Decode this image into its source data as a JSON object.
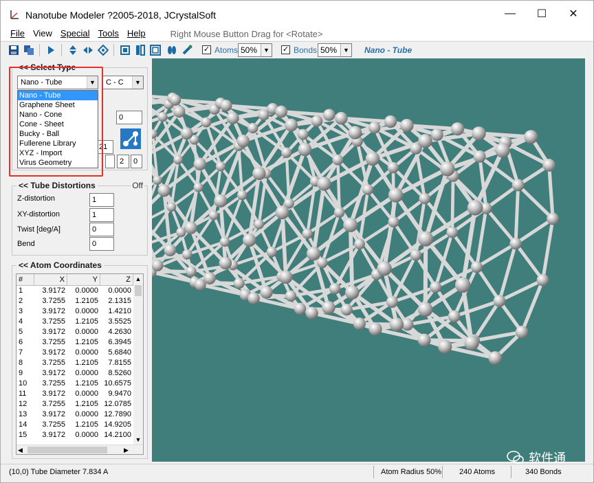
{
  "window": {
    "title": "Nanotube Modeler ?2005-2018, JCrystalSoft",
    "controls": {
      "minimize": "—",
      "maximize": "☐",
      "close": "✕"
    }
  },
  "menu": {
    "file": "File",
    "view": "View",
    "special": "Special",
    "tools": "Tools",
    "help": "Help",
    "hint": "Right Mouse Button Drag for <Rotate>"
  },
  "toolbar": {
    "atoms_checked": true,
    "atoms_label": "Atoms",
    "atoms_percent": "50%",
    "bonds_checked": true,
    "bonds_label": "Bonds",
    "bonds_percent": "50%",
    "mode_label": "Nano - Tube"
  },
  "select_type": {
    "title": "<< Select Type",
    "type_value": "Nano - Tube",
    "bond_value": "C - C",
    "options": [
      "Nano - Tube",
      "Graphene Sheet",
      "Nano - Cone",
      "Cone - Sheet",
      "Bucky - Ball",
      "Fullerene Library",
      "XYZ - Import",
      "Virus Geometry"
    ],
    "selected_index": 0,
    "hidden_field_1": "0",
    "hidden_field_2": "21",
    "hidden_field_3": "2",
    "hidden_field_4": "0"
  },
  "tube_distortions": {
    "title": "<< Tube Distortions",
    "state": "Off",
    "z_label": "Z-distortion",
    "z_value": "1",
    "xy_label": "XY-distortion",
    "xy_value": "1",
    "twist_label": "Twist [deg/A]",
    "twist_value": "0",
    "bend_label": "Bend",
    "bend_value": "0"
  },
  "atom_coordinates": {
    "title": "<< Atom Coordinates",
    "columns": [
      "#",
      "X",
      "Y",
      "Z"
    ],
    "rows": [
      [
        "1",
        "3.9172",
        "0.0000",
        "0.0000"
      ],
      [
        "2",
        "3.7255",
        "1.2105",
        "2.1315"
      ],
      [
        "3",
        "3.9172",
        "0.0000",
        "1.4210"
      ],
      [
        "4",
        "3.7255",
        "1.2105",
        "3.5525"
      ],
      [
        "5",
        "3.9172",
        "0.0000",
        "4.2630"
      ],
      [
        "6",
        "3.7255",
        "1.2105",
        "6.3945"
      ],
      [
        "7",
        "3.9172",
        "0.0000",
        "5.6840"
      ],
      [
        "8",
        "3.7255",
        "1.2105",
        "7.8155"
      ],
      [
        "9",
        "3.9172",
        "0.0000",
        "8.5260"
      ],
      [
        "10",
        "3.7255",
        "1.2105",
        "10.6575"
      ],
      [
        "11",
        "3.9172",
        "0.0000",
        "9.9470"
      ],
      [
        "12",
        "3.7255",
        "1.2105",
        "12.0785"
      ],
      [
        "13",
        "3.9172",
        "0.0000",
        "12.7890"
      ],
      [
        "14",
        "3.7255",
        "1.2105",
        "14.9205"
      ],
      [
        "15",
        "3.9172",
        "0.0000",
        "14.2100"
      ]
    ]
  },
  "status": {
    "tube_info": "(10,0) Tube Diameter 7.834 A",
    "atom_radius": "Atom Radius 50%",
    "atoms_count": "240 Atoms",
    "bonds_count": "340 Bonds"
  },
  "watermark": "软件通",
  "colors": {
    "viewport": "#3f7e7b",
    "accent": "#2a6fa8",
    "highlight": "#3297fd",
    "callout": "#e5302a"
  }
}
